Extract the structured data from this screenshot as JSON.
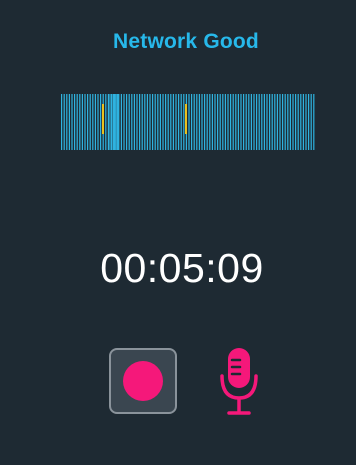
{
  "status": {
    "text": "Network Good",
    "color": "#27b8ea"
  },
  "waveform": {
    "bar_color": "#2fb3e0",
    "marker_color": "#e8c21e",
    "markers": 2
  },
  "timer": {
    "elapsed": "00:05:09"
  },
  "controls": {
    "record_icon": "record-icon",
    "record_color": "#f5187a",
    "mic_icon": "microphone-icon",
    "mic_color": "#f5187a"
  },
  "colors": {
    "background": "#1e2a33",
    "text": "#ffffff"
  }
}
